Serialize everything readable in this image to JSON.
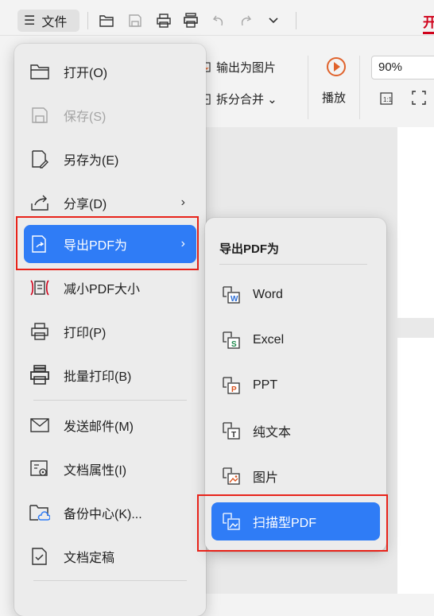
{
  "toolbar": {
    "menu_glyph": "☰",
    "file_label": "文件",
    "right_tab_label": "开",
    "icons": [
      "folder-open-icon",
      "save-icon",
      "print-icon",
      "batch-print-icon",
      "undo-icon",
      "redo-icon",
      "chevron-down-icon"
    ]
  },
  "ribbon": {
    "export_image_label": "输出为图片",
    "split_merge_label": "拆分合并 ⌄",
    "play_label": "播放",
    "zoom_value": "90%"
  },
  "menu": {
    "items": [
      {
        "label": "打开(O)",
        "icon": "folder-open-icon",
        "enabled": true
      },
      {
        "label": "保存(S)",
        "icon": "save-icon",
        "enabled": false
      },
      {
        "label": "另存为(E)",
        "icon": "save-as-icon",
        "enabled": true
      },
      {
        "label": "分享(D)",
        "icon": "share-icon",
        "enabled": true,
        "submenu": true
      },
      {
        "label": "导出PDF为",
        "icon": "export-pdf-icon",
        "enabled": true,
        "submenu": true,
        "selected": true
      },
      {
        "label": "减小PDF大小",
        "icon": "compress-icon",
        "enabled": true
      },
      {
        "label": "打印(P)",
        "icon": "print-icon",
        "enabled": true
      },
      {
        "label": "批量打印(B)",
        "icon": "batch-print-icon",
        "enabled": true
      },
      {
        "label": "发送邮件(M)",
        "icon": "mail-icon",
        "enabled": true
      },
      {
        "label": "文档属性(I)",
        "icon": "properties-icon",
        "enabled": true
      },
      {
        "label": "备份中心(K)...",
        "icon": "backup-cloud-icon",
        "enabled": true
      },
      {
        "label": "文档定稿",
        "icon": "finalize-icon",
        "enabled": true
      }
    ],
    "chevron": "›"
  },
  "submenu": {
    "title": "导出PDF为",
    "items": [
      {
        "label": "Word",
        "icon": "word-file-icon",
        "badge": "W",
        "badge_color": "#2f6fd6"
      },
      {
        "label": "Excel",
        "icon": "excel-file-icon",
        "badge": "S",
        "badge_color": "#1e8a4c"
      },
      {
        "label": "PPT",
        "icon": "ppt-file-icon",
        "badge": "P",
        "badge_color": "#d9531e"
      },
      {
        "label": "纯文本",
        "icon": "text-file-icon",
        "badge": "T",
        "badge_color": "#333333"
      },
      {
        "label": "图片",
        "icon": "image-file-icon",
        "badge": "",
        "badge_color": "#d9531e"
      },
      {
        "label": "扫描型PDF",
        "icon": "scan-pdf-icon",
        "selected": true
      }
    ]
  },
  "colors": {
    "accent": "#2f7cf6",
    "highlight_box": "#e8231a",
    "play": "#e0622b"
  }
}
